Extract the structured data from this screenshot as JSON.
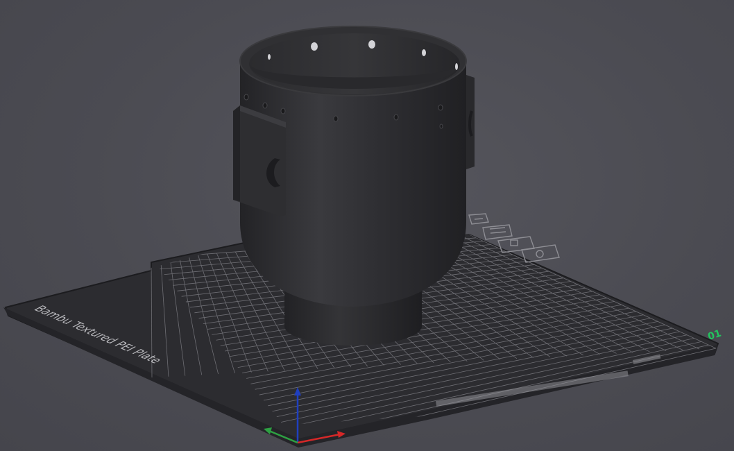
{
  "viewport": {
    "background": "#4b4b52"
  },
  "build_plate": {
    "label": "Bambu Textured PEI Plate",
    "plate_number": "01",
    "grid_color": "#7a7a80",
    "surface_color": "#2c2c30"
  },
  "model": {
    "name": "cup-shaped part",
    "color": "#2f2f31"
  },
  "plate_tools": [
    {
      "icon": "arrange-icon"
    },
    {
      "icon": "orient-icon"
    },
    {
      "icon": "lock-icon"
    },
    {
      "icon": "settings-icon"
    }
  ],
  "axes": {
    "x_color": "#d62828",
    "y_color": "#2ea043",
    "z_color": "#1f3fbf"
  }
}
